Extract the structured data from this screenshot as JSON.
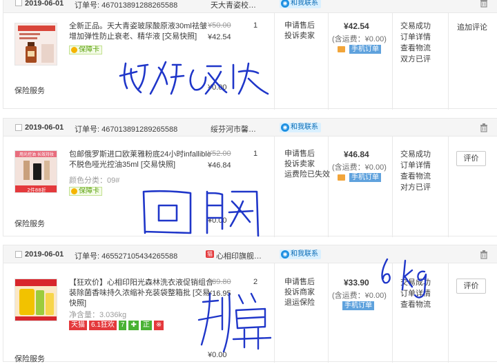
{
  "orders": [
    {
      "date": "2019-06-01",
      "order_no": "订单号: 467013891288265588",
      "shop": "天大青姿校…",
      "contact": "和我联系",
      "title": "全新正品。天大青姿玻尿酸原液30ml祛皱增加弹性防止衰老、精华液 [交易快照]",
      "sub": "",
      "badge": "保障卡",
      "price_old": "¥50.00",
      "price_now": "¥42.54",
      "qty": "1",
      "services": [
        "申请售后",
        "投诉卖家"
      ],
      "total": "¥42.54",
      "shipping": "(含运费：¥0.00)",
      "mobile": "手机订单",
      "status": [
        "交易成功",
        "订单详情",
        "查看物流",
        "双方已评"
      ],
      "action": "追加评论",
      "action_is_button": false,
      "insurance": "保险服务",
      "insurance_price": "¥0.00",
      "handwriting": "好以及收",
      "thumb_colors": [
        "#f7e9e4",
        "#d94a3a",
        "#6b2a1a"
      ]
    },
    {
      "date": "2019-06-01",
      "order_no": "订单号: 467013891289265588",
      "shop": "绥芬河市馨…",
      "contact": "和我联系",
      "title": "包邮俄罗斯进口欧莱雅粉底24小时infallible不脱色哑光控油35ml [交易快照]",
      "sub": "颜色分类：09#",
      "badge": "保障卡",
      "price_old": "¥52.00",
      "price_now": "¥46.84",
      "qty": "1",
      "services": [
        "申请售后",
        "投诉卖家",
        "运费险已失效"
      ],
      "total": "¥46.84",
      "shipping": "(含运费：¥0.00)",
      "mobile": "手机订单",
      "status": [
        "交易成功",
        "订单详情",
        "查看物流",
        "对方已评"
      ],
      "action": "评价",
      "action_is_button": true,
      "insurance": "保险服务",
      "insurance_price": "¥0.00",
      "handwriting": "回购",
      "thumb_text_top": "用光控油 长效持妆",
      "thumb_text_bottom": "2件88折"
    },
    {
      "date": "2019-06-01",
      "order_no": "订单号: 465527105434265588",
      "shop": "心相印旗舰…",
      "contact": "和我联系",
      "title": "【狂欢价】心相印阳光森林洗衣液促销组合装除菌香味持久浓缩补充装袋整箱批 [交易快照]",
      "sub": "净含量：3.036kg",
      "tags": [
        {
          "text": "天猫",
          "color": "#e4393c"
        },
        {
          "text": "6.1狂欢",
          "color": "#e4393c"
        },
        {
          "text": "7",
          "color": "#49b234"
        },
        {
          "text": "✚",
          "color": "#49b234"
        },
        {
          "text": "正",
          "color": "#49b234"
        },
        {
          "text": "※",
          "color": "#e4393c"
        }
      ],
      "price_old": "¥89.80",
      "price_now": "¥16.95",
      "qty": "2",
      "services": [
        "申请售后",
        "投诉商家",
        "退运保险"
      ],
      "total": "¥33.90",
      "shipping": "(含运费：¥0.00)",
      "mobile": "手机订单",
      "status": [
        "交易成功",
        "订单详情",
        "查看物流"
      ],
      "action": "评价",
      "action_is_button": true,
      "insurance": "保险服务",
      "insurance_price": "¥0.00",
      "handwriting": "划算",
      "handwriting_note": "6 kg"
    }
  ]
}
